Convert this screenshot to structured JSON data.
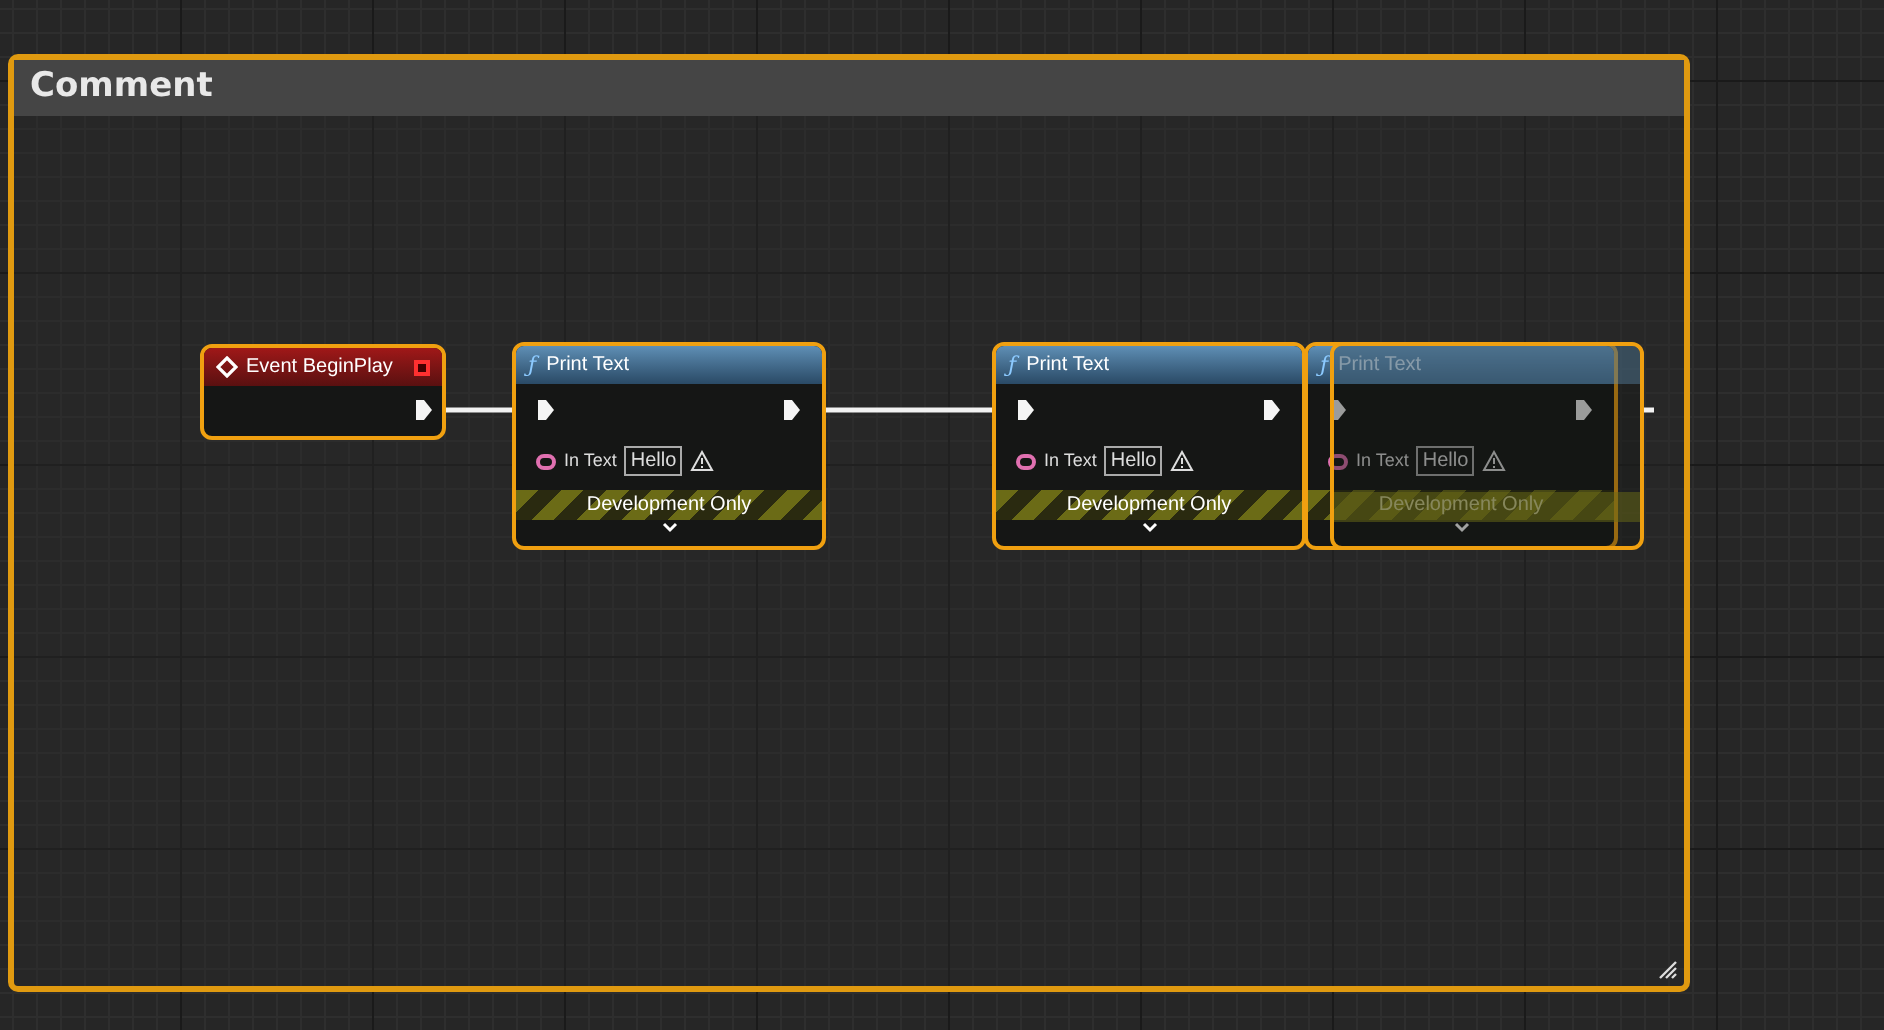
{
  "comment": {
    "title": "Comment"
  },
  "nodes": [
    {
      "kind": "event",
      "title": "Event BeginPlay",
      "selected": true,
      "ghost": false
    },
    {
      "kind": "function",
      "icon": "ƒ",
      "title": "Print Text",
      "selected": true,
      "ghost": false,
      "input_label": "In Text",
      "value": "Hello",
      "banner": "Development Only"
    },
    {
      "kind": "function",
      "icon": "ƒ",
      "title": "Print Text",
      "selected": true,
      "ghost": false,
      "input_label": "In Text",
      "value": "Hello",
      "banner": "Development Only"
    },
    {
      "kind": "function",
      "icon": "ƒ",
      "title": "Print Text",
      "selected": true,
      "ghost": false,
      "input_label": "In Text",
      "value": "Hello",
      "banner": "Development Only"
    },
    {
      "kind": "function",
      "selected": true,
      "ghost": true
    }
  ]
}
